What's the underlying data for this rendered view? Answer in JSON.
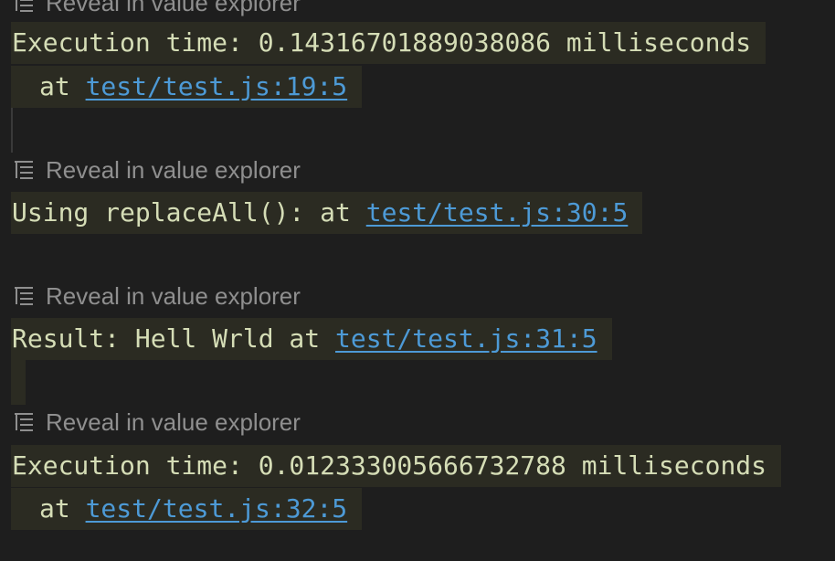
{
  "entries": [
    {
      "reveal_label": "Reveal in value explorer",
      "line1": "Execution time: 0.14316701889038086 milliseconds",
      "at_label": "at",
      "link": "test/test.js:19:5"
    },
    {
      "reveal_label": "Reveal in value explorer",
      "line1": "Using replaceAll(): at",
      "link": "test/test.js:30:5"
    },
    {
      "reveal_label": "Reveal in value explorer",
      "line1": "Result: Hell Wrld at",
      "link": "test/test.js:31:5"
    },
    {
      "reveal_label": "Reveal in value explorer",
      "line1": "Execution time: 0.012333005666732788 milliseconds",
      "at_label": "at",
      "link": "test/test.js:32:5"
    }
  ],
  "icons": {
    "reveal": "list-tree-icon"
  },
  "colors": {
    "background": "#1e1e1e",
    "highlight": "#2b2b22",
    "text": "#d5ddb6",
    "link": "#4d9ad6",
    "muted": "#8f8f8f"
  }
}
